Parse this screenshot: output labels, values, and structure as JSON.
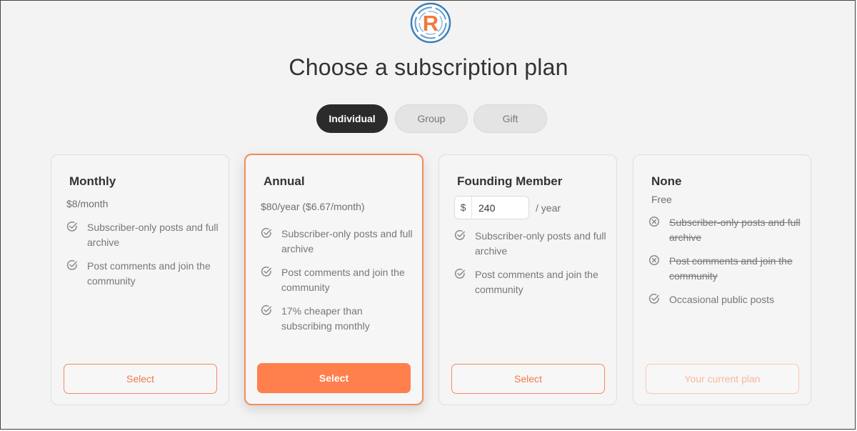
{
  "page": {
    "title": "Choose a subscription plan",
    "logo_letter": "R"
  },
  "tabs": [
    {
      "label": "Individual",
      "active": true
    },
    {
      "label": "Group",
      "active": false
    },
    {
      "label": "Gift",
      "active": false
    }
  ],
  "plans": [
    {
      "name": "Monthly",
      "price": "$8/month",
      "features": [
        {
          "text": "Subscriber-only posts and full archive",
          "included": true
        },
        {
          "text": "Post comments and join the community",
          "included": true
        }
      ],
      "button": "Select"
    },
    {
      "name": "Annual",
      "price": "$80/year ($6.67/month)",
      "features": [
        {
          "text": "Subscriber-only posts and full archive",
          "included": true
        },
        {
          "text": "Post comments and join the community",
          "included": true
        },
        {
          "text": "17% cheaper than subscribing monthly",
          "included": true
        }
      ],
      "button": "Select"
    },
    {
      "name": "Founding Member",
      "currency_symbol": "$",
      "amount": "240",
      "period": "/ year",
      "features": [
        {
          "text": "Subscriber-only posts and full archive",
          "included": true
        },
        {
          "text": "Post comments and join the community",
          "included": true
        }
      ],
      "button": "Select"
    },
    {
      "name": "None",
      "price": "Free",
      "features": [
        {
          "text": "Subscriber-only posts and full archive",
          "included": false
        },
        {
          "text": "Post comments and join the community",
          "included": false
        },
        {
          "text": "Occasional public posts",
          "included": true
        }
      ],
      "button": "Your current plan"
    }
  ],
  "icons": {
    "included": "check-circle-icon",
    "excluded": "x-circle-icon"
  },
  "colors": {
    "accent": "#ff7f4d",
    "dark_tab": "#2b2b2b",
    "logo_blue": "#3d7fb6"
  }
}
